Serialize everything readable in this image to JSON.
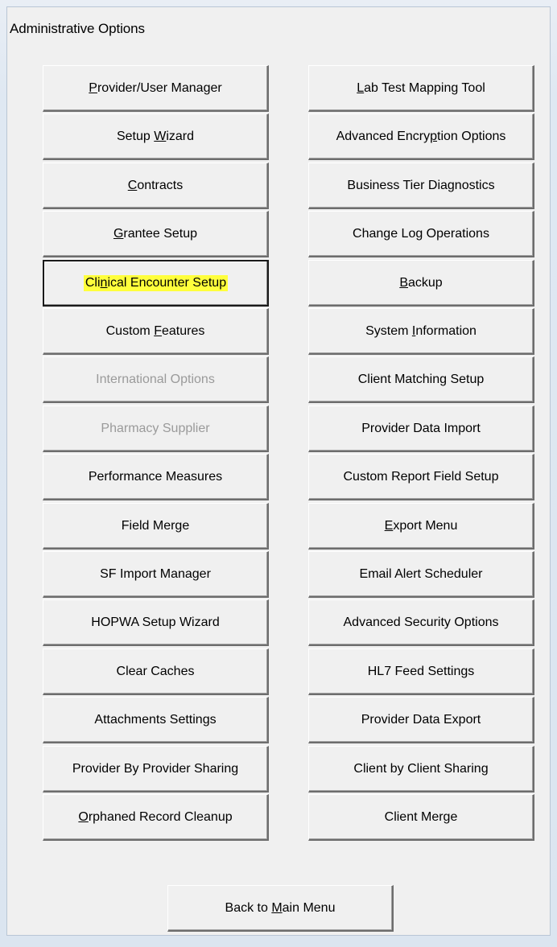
{
  "window": {
    "title": "Administrative Options"
  },
  "left_buttons": [
    {
      "label": "Provider/User Manager",
      "mnemonic": "P",
      "enabled": true
    },
    {
      "label": "Setup Wizard",
      "mnemonic": "W",
      "enabled": true
    },
    {
      "label": "Contracts",
      "mnemonic": "C",
      "enabled": true
    },
    {
      "label": "Grantee Setup",
      "mnemonic": "G",
      "enabled": true
    },
    {
      "label": "Clinical Encounter Setup",
      "mnemonic": "n",
      "enabled": true,
      "focused": true,
      "highlight": "#ffff3c"
    },
    {
      "label": "Custom Features",
      "mnemonic": "F",
      "enabled": true
    },
    {
      "label": "International Options",
      "enabled": false
    },
    {
      "label": "Pharmacy Supplier",
      "enabled": false
    },
    {
      "label": "Performance Measures",
      "enabled": true
    },
    {
      "label": "Field Merge",
      "enabled": true
    },
    {
      "label": "SF Import Manager",
      "enabled": true
    },
    {
      "label": "HOPWA Setup Wizard",
      "enabled": true
    },
    {
      "label": "Clear Caches",
      "enabled": true
    },
    {
      "label": "Attachments Settings",
      "enabled": true
    },
    {
      "label": "Provider By Provider Sharing",
      "enabled": true
    },
    {
      "label": "Orphaned Record Cleanup",
      "mnemonic": "O",
      "enabled": true
    }
  ],
  "right_buttons": [
    {
      "label": "Lab Test Mapping Tool",
      "mnemonic": "L",
      "enabled": true
    },
    {
      "label": "Advanced Encryption Options",
      "mnemonic": "p",
      "enabled": true
    },
    {
      "label": "Business Tier Diagnostics",
      "enabled": true
    },
    {
      "label": "Change Log Operations",
      "enabled": true
    },
    {
      "label": "Backup",
      "mnemonic": "B",
      "enabled": true
    },
    {
      "label": "System Information",
      "mnemonic": "I",
      "enabled": true
    },
    {
      "label": "Client Matching Setup",
      "enabled": true
    },
    {
      "label": "Provider Data Import",
      "enabled": true
    },
    {
      "label": "Custom Report Field Setup",
      "enabled": true
    },
    {
      "label": "Export Menu",
      "mnemonic": "E",
      "enabled": true
    },
    {
      "label": "Email Alert Scheduler",
      "enabled": true
    },
    {
      "label": "Advanced Security Options",
      "enabled": true
    },
    {
      "label": "HL7 Feed Settings",
      "enabled": true
    },
    {
      "label": "Provider Data Export",
      "enabled": true
    },
    {
      "label": "Client by Client Sharing",
      "enabled": true
    },
    {
      "label": "Client Merge",
      "enabled": true
    }
  ],
  "footer": {
    "back_label": "Back to Main Menu",
    "back_mnemonic": "M"
  }
}
